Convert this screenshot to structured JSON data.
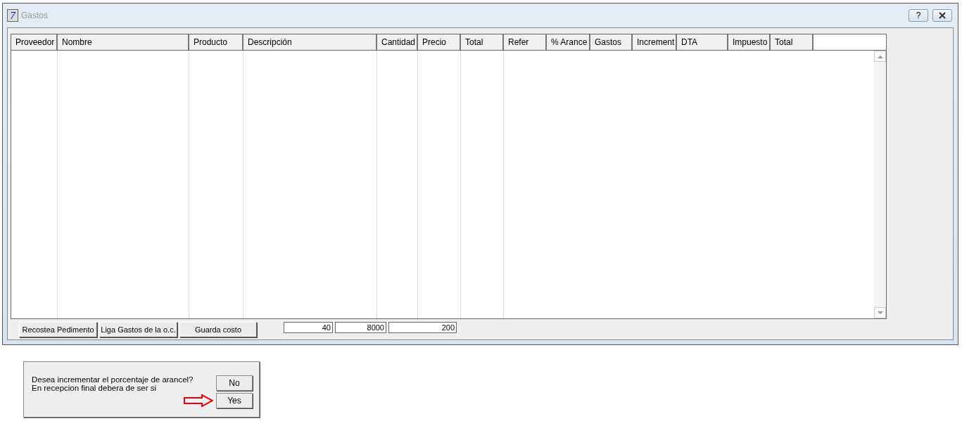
{
  "window": {
    "icon_text": "7",
    "title": "Gastos",
    "help": "?"
  },
  "table": {
    "columns": [
      {
        "label": "Proveedor",
        "ruled": true
      },
      {
        "label": "Nombre",
        "ruled": true
      },
      {
        "label": "Producto",
        "ruled": true
      },
      {
        "label": "Descripción",
        "ruled": true
      },
      {
        "label": "Cantidad",
        "ruled": true
      },
      {
        "label": "Precio",
        "ruled": true
      },
      {
        "label": "Total",
        "ruled": true
      },
      {
        "label": "Refer",
        "ruled": false
      },
      {
        "label": "% Arance",
        "ruled": false
      },
      {
        "label": "Gastos",
        "ruled": false
      },
      {
        "label": "Increment",
        "ruled": false
      },
      {
        "label": "DTA",
        "ruled": false
      },
      {
        "label": "Impuesto",
        "ruled": false
      },
      {
        "label": "Total",
        "ruled": false
      }
    ]
  },
  "buttons": [
    "Recostea Pedimento",
    "Liga Gastos de la o.c.",
    "Guarda costo"
  ],
  "totals": [
    "40",
    "8000",
    "200"
  ],
  "dialog": {
    "message": [
      "Desea incrementar el porcentaje de arancel?",
      "En recepcion final debera de ser si"
    ],
    "buttons": [
      {
        "label": "No",
        "pointed": false
      },
      {
        "label": "Yes",
        "pointed": true
      }
    ]
  }
}
